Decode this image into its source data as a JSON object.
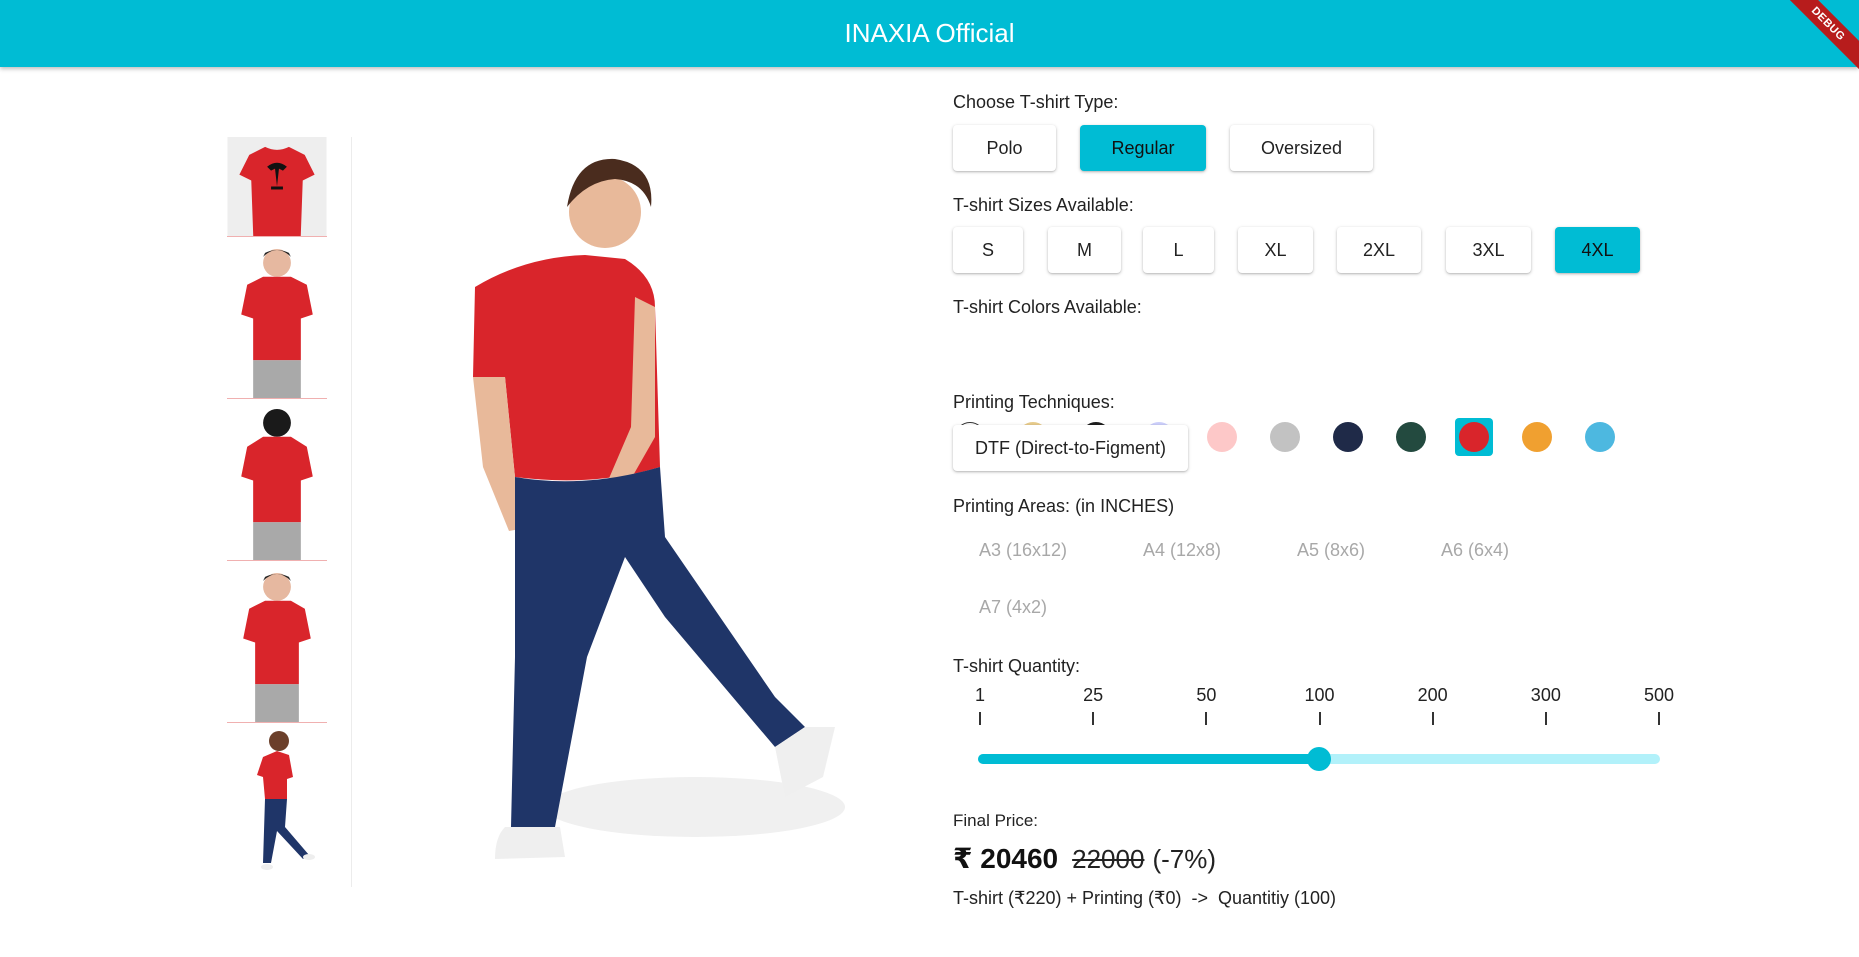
{
  "app": {
    "title": "INAXIA Official",
    "debug_banner": "DEBUG"
  },
  "gallery": {
    "thumbnails": [
      "tshirt-front-print-icon",
      "model-front-icon",
      "model-back-icon",
      "model-front-icon",
      "model-jeans-icon"
    ]
  },
  "tshirt_type": {
    "label": "Choose T-shirt Type:",
    "options": [
      "Polo",
      "Regular",
      "Oversized"
    ],
    "selected": "Regular"
  },
  "sizes": {
    "label": "T-shirt Sizes Available:",
    "options": [
      "S",
      "M",
      "L",
      "XL",
      "2XL",
      "3XL",
      "4XL"
    ],
    "selected": "4XL"
  },
  "colors": {
    "label": "T-shirt Colors Available:",
    "options": [
      "#ffffff",
      "#e8cc8c",
      "#1e1e1e",
      "#cdd0fb",
      "#fdc8c8",
      "#c2c2c2",
      "#1f2a48",
      "#234a3f",
      "#d9252b",
      "#f0a030",
      "#4db8e0"
    ],
    "selected": "#d9252b",
    "accent": "#00bcd4"
  },
  "printing_techniques": {
    "label": "Printing Techniques:",
    "options": [
      "DTF (Direct-to-Figment)"
    ]
  },
  "printing_areas": {
    "label": "Printing Areas: (in INCHES)",
    "options": [
      "A3 (16x12)",
      "A4 (12x8)",
      "A5 (8x6)",
      "A6 (6x4)",
      "A7 (4x2)"
    ]
  },
  "quantity": {
    "label": "T-shirt Quantity:",
    "ticks": [
      "1",
      "25",
      "50",
      "100",
      "200",
      "300",
      "500"
    ],
    "selected": "100",
    "selected_fraction": 0.5
  },
  "price": {
    "label": "Final Price:",
    "final": "₹ 20460",
    "original": "22000",
    "discount": "(-7%)",
    "breakdown": "T-shirt (₹220) + Printing (₹0)  ->  Quantitiy (100)"
  }
}
